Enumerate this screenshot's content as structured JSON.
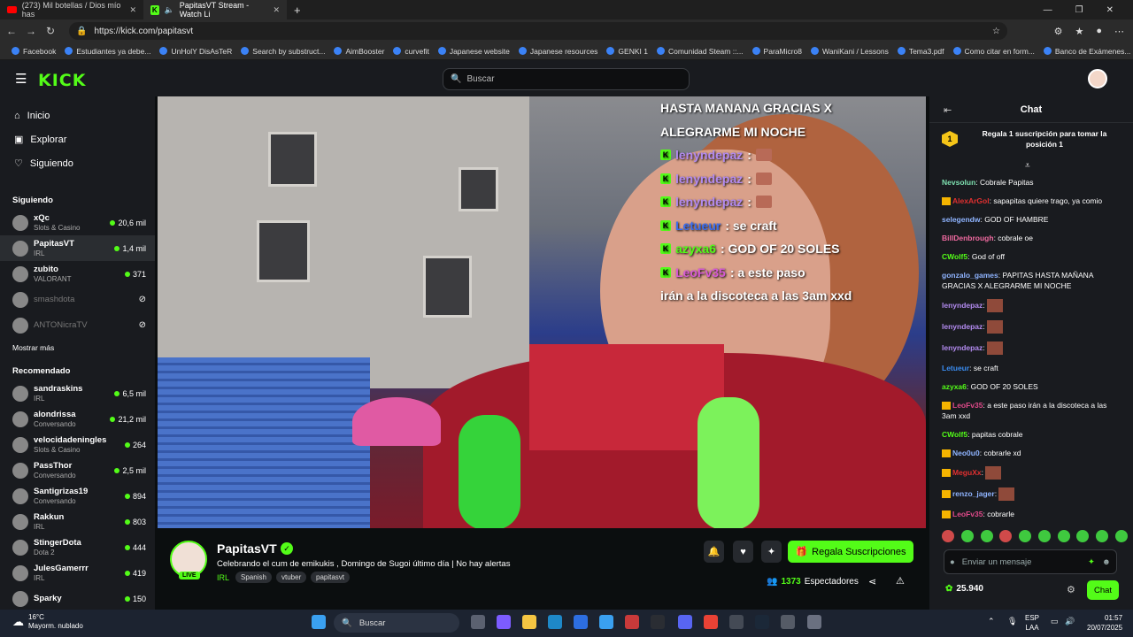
{
  "browser": {
    "tabs": [
      {
        "label": "(273) Mil botellas / Dios mío has",
        "icon": "youtube-icon"
      },
      {
        "label": "PapitasVT Stream - Watch Li",
        "icon": "kick-icon"
      }
    ],
    "new_tab": "+",
    "url": "https://kick.com/papitasvt",
    "bookmarks": [
      "Facebook",
      "Estudiantes ya debe...",
      "UnHolY DisAsTeR",
      "Search by substruct...",
      "AimBooster",
      "curvefit",
      "Japanese website",
      "Japanese resources",
      "GENKI 1",
      "Comunidad Steam ::...",
      "ParaMicro8",
      "WaniKani / Lessons",
      "Tema3.pdf",
      "Como citar en form...",
      "Banco de Exámenes..."
    ]
  },
  "header": {
    "logo": "KICK",
    "search_placeholder": "Buscar"
  },
  "sidebar": {
    "nav": [
      "Inicio",
      "Explorar",
      "Siguiendo"
    ],
    "following_title": "Siguiendo",
    "following": [
      {
        "name": "xQc",
        "category": "Slots & Casino",
        "viewers": "20,6 mil",
        "live": true
      },
      {
        "name": "PapitasVT",
        "category": "IRL",
        "viewers": "1,4 mil",
        "live": true
      },
      {
        "name": "zubito",
        "category": "VALORANT",
        "viewers": "371",
        "live": true
      },
      {
        "name": "smashdota",
        "category": "",
        "viewers": "",
        "live": false
      },
      {
        "name": "ANTONicraTV",
        "category": "",
        "viewers": "",
        "live": false
      }
    ],
    "show_more": "Mostrar más",
    "recommended_title": "Recomendado",
    "recommended": [
      {
        "name": "sandraskins",
        "category": "IRL",
        "viewers": "6,5 mil"
      },
      {
        "name": "alondrissa",
        "category": "Conversando",
        "viewers": "21,2 mil"
      },
      {
        "name": "velocidadeningles",
        "category": "Slots & Casino",
        "viewers": "264"
      },
      {
        "name": "PassThor",
        "category": "Conversando",
        "viewers": "2,5 mil"
      },
      {
        "name": "Santigrizas19",
        "category": "Conversando",
        "viewers": "894"
      },
      {
        "name": "Rakkun",
        "category": "IRL",
        "viewers": "803"
      },
      {
        "name": "StingerDota",
        "category": "Dota 2",
        "viewers": "444"
      },
      {
        "name": "JulesGamerrr",
        "category": "IRL",
        "viewers": "419"
      },
      {
        "name": "Sparky",
        "category": "",
        "viewers": "150"
      }
    ]
  },
  "overlay": {
    "lines": [
      {
        "user": "",
        "text": "HASTA MANANA GRACIAS X",
        "color": "#ffffff"
      },
      {
        "user": "",
        "text": "ALEGRARME MI NOCHE",
        "color": "#ffffff"
      },
      {
        "user": "lenyndepaz",
        "text": ":",
        "color": "#b38bf0",
        "emote": true
      },
      {
        "user": "lenyndepaz",
        "text": ":",
        "color": "#b38bf0",
        "emote": true
      },
      {
        "user": "lenyndepaz",
        "text": ":",
        "color": "#b38bf0",
        "emote": true
      },
      {
        "user": "Letueur",
        "text": ": se craft",
        "color": "#3a6df0"
      },
      {
        "user": "azyxa6",
        "text": ": GOD OF 20 SOLES",
        "color": "#53fc18"
      },
      {
        "user": "LeoFv35",
        "text": ": a este paso",
        "color": "#d65ad6"
      },
      {
        "user": "",
        "text": "irán a la discoteca a las 3am xxd",
        "color": "#ffffff"
      }
    ]
  },
  "stream": {
    "name": "PapitasVT",
    "live_badge": "LIVE",
    "title": "Celebrando el cum de emikukis , Domingo de Sugoi último día | No hay alertas",
    "category": "IRL",
    "tags": [
      "Spanish",
      "vtuber",
      "papitasvt"
    ],
    "subscribe_label": "Regala Suscripciones",
    "viewers_count": "1373",
    "viewers_label": "Espectadores"
  },
  "chat": {
    "title": "Chat",
    "pinned": "Regala 1 suscripción para tomar la posición 1",
    "rank": "1",
    "messages": [
      {
        "user": "Nevsolun",
        "color": "#7ee0b0",
        "text": "Cobrale Papitas"
      },
      {
        "user": "AlexArGol",
        "color": "#e03030",
        "text": "sapapitas quiere trago, ya comio"
      },
      {
        "user": "selegendw",
        "color": "#8fb4ff",
        "text": "GOD OF HAMBRE"
      },
      {
        "user": "BillDenbrough",
        "color": "#f06aa0",
        "text": "cobrale oe"
      },
      {
        "user": "CWolf5",
        "color": "#53fc18",
        "text": "God of off"
      },
      {
        "user": "gonzalo_games",
        "color": "#8fb4ff",
        "text": "PAPITAS HASTA MAÑANA GRACIAS X ALEGRARME MI NOCHE"
      },
      {
        "user": "lenyndepaz",
        "color": "#b38bf0",
        "text": "",
        "emote": true
      },
      {
        "user": "lenyndepaz",
        "color": "#b38bf0",
        "text": "",
        "emote": true
      },
      {
        "user": "lenyndepaz",
        "color": "#b38bf0",
        "text": "",
        "emote": true
      },
      {
        "user": "Letueur",
        "color": "#3a8cf0",
        "text": "se craft"
      },
      {
        "user": "azyxa6",
        "color": "#53fc18",
        "text": "GOD OF 20 SOLES"
      },
      {
        "user": "LeoFv35",
        "color": "#e04a8a",
        "text": "a este paso irán a la discoteca a las 3am xxd"
      },
      {
        "user": "CWolf5",
        "color": "#53fc18",
        "text": "papitas cobrale"
      },
      {
        "user": "Neo0u0",
        "color": "#8fb4ff",
        "text": "cobrarle xd"
      },
      {
        "user": "MeguXx",
        "color": "#e03030",
        "text": "",
        "emote": true
      },
      {
        "user": "renzo_jager",
        "color": "#8fb4ff",
        "text": "",
        "emote": true
      },
      {
        "user": "LeoFv35",
        "color": "#e04a8a",
        "text": "cobrarle"
      }
    ],
    "input_placeholder": "Enviar un mensaje",
    "points": "25.940",
    "send_label": "Chat"
  },
  "taskbar": {
    "temp": "16°C",
    "weather": "Mayorm. nublado",
    "search": "Buscar",
    "lang1": "ESP",
    "lang2": "LAA",
    "time": "01:57",
    "date": "20/07/2025"
  },
  "colors": {
    "kick_green": "#53fc18",
    "bg": "#0b0e0f",
    "panel": "#191b1f"
  }
}
